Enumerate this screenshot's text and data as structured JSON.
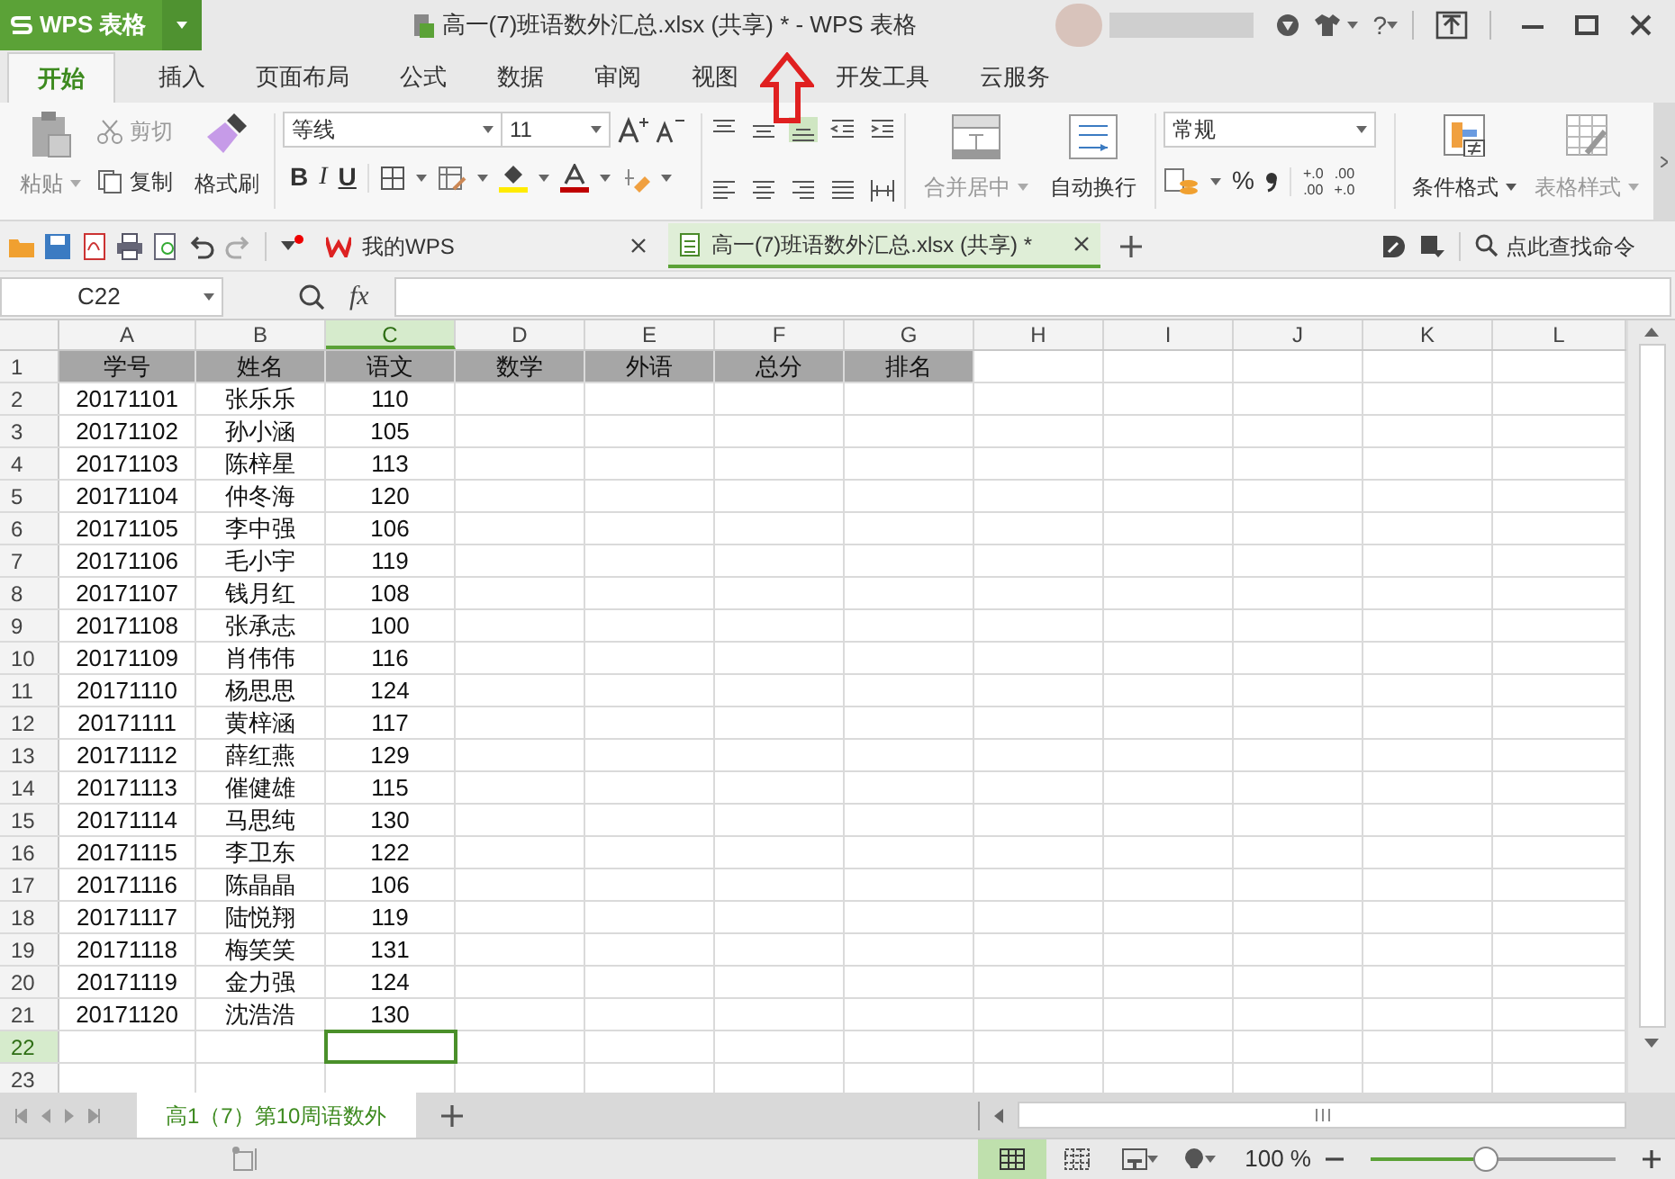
{
  "title_bar": {
    "app_button": "WPS 表格",
    "document_title": "高一(7)班语数外汇总.xlsx (共享) * - WPS 表格",
    "help": "?"
  },
  "menu_tabs": [
    {
      "label": "开始",
      "selected": true
    },
    {
      "label": "插入",
      "selected": false
    },
    {
      "label": "页面布局",
      "selected": false
    },
    {
      "label": "公式",
      "selected": false
    },
    {
      "label": "数据",
      "selected": false
    },
    {
      "label": "审阅",
      "selected": false
    },
    {
      "label": "视图",
      "selected": false
    },
    {
      "label": "开发工具",
      "selected": false
    },
    {
      "label": "云服务",
      "selected": false
    }
  ],
  "ribbon": {
    "paste": "粘贴",
    "cut": {
      "label": "剪切",
      "disabled": true
    },
    "copy": {
      "label": "复制",
      "disabled": false
    },
    "format_painter": "格式刷",
    "font_name": "等线",
    "font_size": "11",
    "bold": "B",
    "italic": "I",
    "underline": "U",
    "number_format": "常规",
    "percent": "%",
    "increase_decimal": [
      "+.0",
      ".00"
    ],
    "decrease_decimal": [
      ".00",
      "+.0"
    ],
    "buttons": [
      {
        "label": "合并居中",
        "disabled": true
      },
      {
        "label": "自动换行",
        "disabled": false
      }
    ],
    "styles": [
      {
        "label": "条件格式",
        "disabled": false
      },
      {
        "label": "表格样式",
        "disabled": true
      }
    ]
  },
  "doc_tabs": [
    {
      "label": "我的WPS",
      "selected": false
    },
    {
      "label": "高一(7)班语数外汇总.xlsx (共享) *",
      "selected": true
    }
  ],
  "command_search": {
    "placeholder": "点此查找命令"
  },
  "formula_bar": {
    "name_box": "C22",
    "fx": "fx"
  },
  "columns": [
    {
      "label": "A",
      "selected": false
    },
    {
      "label": "B",
      "selected": false
    },
    {
      "label": "C",
      "selected": true
    },
    {
      "label": "D",
      "selected": false
    },
    {
      "label": "E",
      "selected": false
    },
    {
      "label": "F",
      "selected": false
    },
    {
      "label": "G",
      "selected": false
    },
    {
      "label": "H",
      "selected": false
    },
    {
      "label": "I",
      "selected": false
    },
    {
      "label": "J",
      "selected": false
    },
    {
      "label": "K",
      "selected": false
    },
    {
      "label": "L",
      "selected": false
    }
  ],
  "rows": [
    {
      "number": "1",
      "kind": "header",
      "selected": false,
      "cells": [
        "学号",
        "姓名",
        "语文",
        "数学",
        "外语",
        "总分",
        "排名"
      ]
    },
    {
      "number": "2",
      "kind": "data",
      "selected": false,
      "cells": [
        "20171101",
        "张乐乐",
        "110"
      ]
    },
    {
      "number": "3",
      "kind": "data",
      "selected": false,
      "cells": [
        "20171102",
        "孙小涵",
        "105"
      ]
    },
    {
      "number": "4",
      "kind": "data",
      "selected": false,
      "cells": [
        "20171103",
        "陈梓星",
        "113"
      ]
    },
    {
      "number": "5",
      "kind": "data",
      "selected": false,
      "cells": [
        "20171104",
        "仲冬海",
        "120"
      ]
    },
    {
      "number": "6",
      "kind": "data",
      "selected": false,
      "cells": [
        "20171105",
        "李中强",
        "106"
      ]
    },
    {
      "number": "7",
      "kind": "data",
      "selected": false,
      "cells": [
        "20171106",
        "毛小宇",
        "119"
      ]
    },
    {
      "number": "8",
      "kind": "data",
      "selected": false,
      "cells": [
        "20171107",
        "钱月红",
        "108"
      ]
    },
    {
      "number": "9",
      "kind": "data",
      "selected": false,
      "cells": [
        "20171108",
        "张承志",
        "100"
      ]
    },
    {
      "number": "10",
      "kind": "data",
      "selected": false,
      "cells": [
        "20171109",
        "肖伟伟",
        "116"
      ]
    },
    {
      "number": "11",
      "kind": "data",
      "selected": false,
      "cells": [
        "20171110",
        "杨思思",
        "124"
      ]
    },
    {
      "number": "12",
      "kind": "data",
      "selected": false,
      "cells": [
        "20171111",
        "黄梓涵",
        "117"
      ]
    },
    {
      "number": "13",
      "kind": "data",
      "selected": false,
      "cells": [
        "20171112",
        "薛红燕",
        "129"
      ]
    },
    {
      "number": "14",
      "kind": "data",
      "selected": false,
      "cells": [
        "20171113",
        "催健雄",
        "115"
      ]
    },
    {
      "number": "15",
      "kind": "data",
      "selected": false,
      "cells": [
        "20171114",
        "马思纯",
        "130"
      ]
    },
    {
      "number": "16",
      "kind": "data",
      "selected": false,
      "cells": [
        "20171115",
        "李卫东",
        "122"
      ]
    },
    {
      "number": "17",
      "kind": "data",
      "selected": false,
      "cells": [
        "20171116",
        "陈晶晶",
        "106"
      ]
    },
    {
      "number": "18",
      "kind": "data",
      "selected": false,
      "cells": [
        "20171117",
        "陆悦翔",
        "119"
      ]
    },
    {
      "number": "19",
      "kind": "data",
      "selected": false,
      "cells": [
        "20171118",
        "梅笑笑",
        "131"
      ]
    },
    {
      "number": "20",
      "kind": "data",
      "selected": false,
      "cells": [
        "20171119",
        "金力强",
        "124"
      ]
    },
    {
      "number": "21",
      "kind": "data",
      "selected": false,
      "cells": [
        "20171120",
        "沈浩浩",
        "130"
      ]
    },
    {
      "number": "22",
      "kind": "data",
      "selected": true
    },
    {
      "number": "23",
      "kind": "data",
      "selected": false
    }
  ],
  "sheet_tabs": [
    {
      "label": "高1（7）第10周语数外",
      "selected": true
    }
  ],
  "status_bar": {
    "zoom": "100 %",
    "zoom_slider": {
      "level": 0.47
    }
  }
}
